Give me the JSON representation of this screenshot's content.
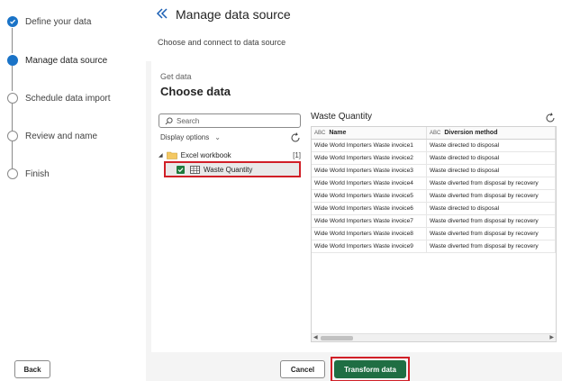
{
  "stepper": {
    "steps": [
      {
        "label": "Define your data",
        "state": "done"
      },
      {
        "label": "Manage data source",
        "state": "current"
      },
      {
        "label": "Schedule data import",
        "state": "pending"
      },
      {
        "label": "Review and name",
        "state": "pending"
      },
      {
        "label": "Finish",
        "state": "pending"
      }
    ]
  },
  "header": {
    "title": "Manage data source",
    "subtitle": "Choose and connect to data source"
  },
  "getdata": {
    "caption": "Get data",
    "heading": "Choose data"
  },
  "navigator": {
    "search_placeholder": "Search",
    "display_options": "Display options",
    "folder": {
      "label": "Excel workbook",
      "count": "[1]"
    },
    "item": {
      "label": "Waste Quantity",
      "checked": true
    }
  },
  "preview": {
    "title": "Waste Quantity",
    "columns": [
      {
        "type_icon": "ABC",
        "label": "Name"
      },
      {
        "type_icon": "ABC",
        "label": "Diversion method"
      }
    ],
    "rows": [
      [
        "Wide World Importers Waste invoice1",
        "Waste directed to disposal"
      ],
      [
        "Wide World Importers Waste invoice2",
        "Waste directed to disposal"
      ],
      [
        "Wide World Importers Waste invoice3",
        "Waste directed to disposal"
      ],
      [
        "Wide World Importers Waste invoice4",
        "Waste diverted from disposal by recovery"
      ],
      [
        "Wide World Importers Waste invoice5",
        "Waste diverted from disposal by recovery"
      ],
      [
        "Wide World Importers Waste invoice6",
        "Waste directed to disposal"
      ],
      [
        "Wide World Importers Waste invoice7",
        "Waste diverted from disposal by recovery"
      ],
      [
        "Wide World Importers Waste invoice8",
        "Waste diverted from disposal by recovery"
      ],
      [
        "Wide World Importers Waste invoice9",
        "Waste diverted from disposal by recovery"
      ]
    ]
  },
  "footer": {
    "back_label": "Back",
    "cancel_label": "Cancel",
    "transform_label": "Transform data"
  },
  "colors": {
    "accent_blue": "#1a73c7",
    "primary_green": "#1f6e43",
    "highlight_red": "#d11f27"
  }
}
